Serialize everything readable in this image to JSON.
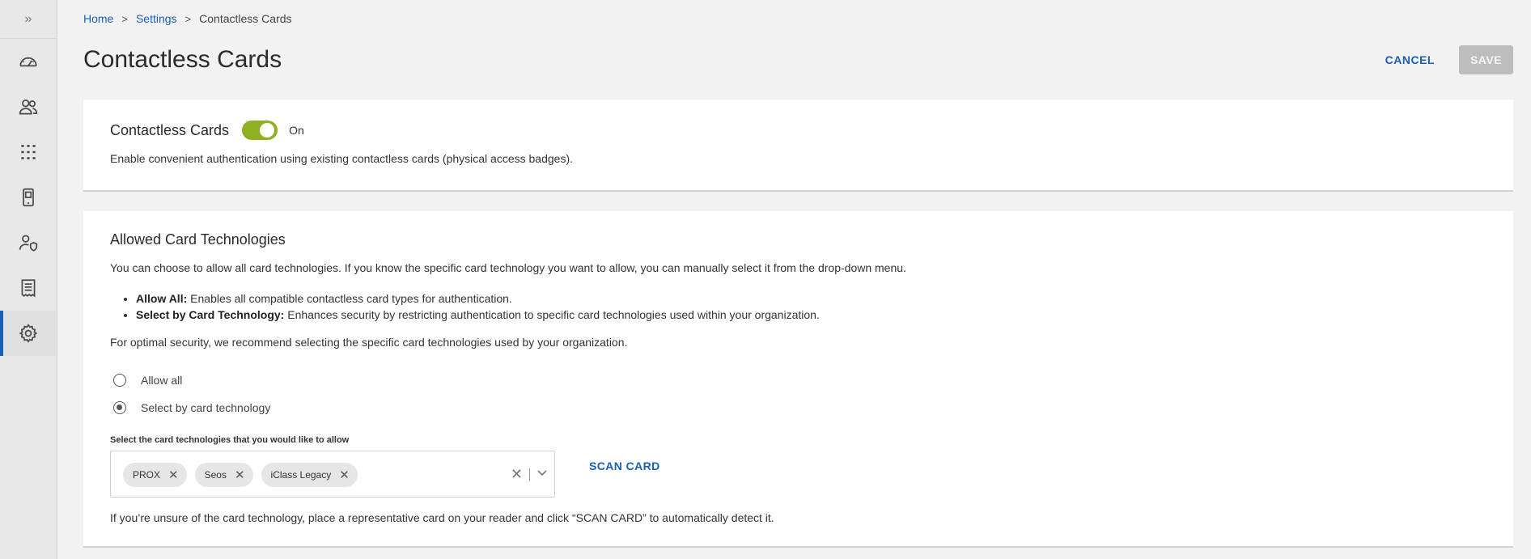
{
  "sidebar": {
    "expand_icon": "»",
    "items": [
      {
        "name": "dashboard",
        "icon": "gauge-icon"
      },
      {
        "name": "users",
        "icon": "users-icon"
      },
      {
        "name": "apps",
        "icon": "grid-icon"
      },
      {
        "name": "devices",
        "icon": "mobile-device-icon"
      },
      {
        "name": "admins",
        "icon": "user-shield-icon"
      },
      {
        "name": "reports",
        "icon": "document-list-icon"
      },
      {
        "name": "settings",
        "icon": "gear-icon",
        "active": true
      }
    ]
  },
  "breadcrumb": {
    "home": "Home",
    "settings": "Settings",
    "current": "Contactless Cards",
    "separator": ">"
  },
  "header": {
    "title": "Contactless Cards",
    "cancel_label": "CANCEL",
    "save_label": "SAVE"
  },
  "toggle_card": {
    "title": "Contactless Cards",
    "toggle_state": "On",
    "description": "Enable convenient authentication using existing contactless cards (physical access badges)."
  },
  "technologies_card": {
    "title": "Allowed Card Technologies",
    "intro": "You can choose to allow all card technologies. If you know the specific card technology you want to allow, you can manually select it from the drop-down menu.",
    "bullets": [
      {
        "term": "Allow All:",
        "text": " Enables all compatible contactless card types for authentication."
      },
      {
        "term": "Select by Card Technology:",
        "text": " Enhances security by restricting authentication to specific card technologies used within your organization."
      }
    ],
    "recommendation": "For optimal security, we recommend selecting the specific card technologies used by your organization.",
    "radio_options": [
      {
        "label": "Allow all",
        "checked": false
      },
      {
        "label": "Select by card technology",
        "checked": true
      }
    ],
    "select_label": "Select the card technologies that you would like to allow",
    "chips": [
      "PROX",
      "Seos",
      "iClass Legacy"
    ],
    "scan_label": "SCAN CARD",
    "hint": "If you’re unsure of the card technology, place a representative card on your reader and click “SCAN CARD” to automatically detect it."
  },
  "colors": {
    "accent": "#1a5fb4",
    "toggle_on": "#8fb021",
    "save_disabled": "#bdbdbd"
  }
}
